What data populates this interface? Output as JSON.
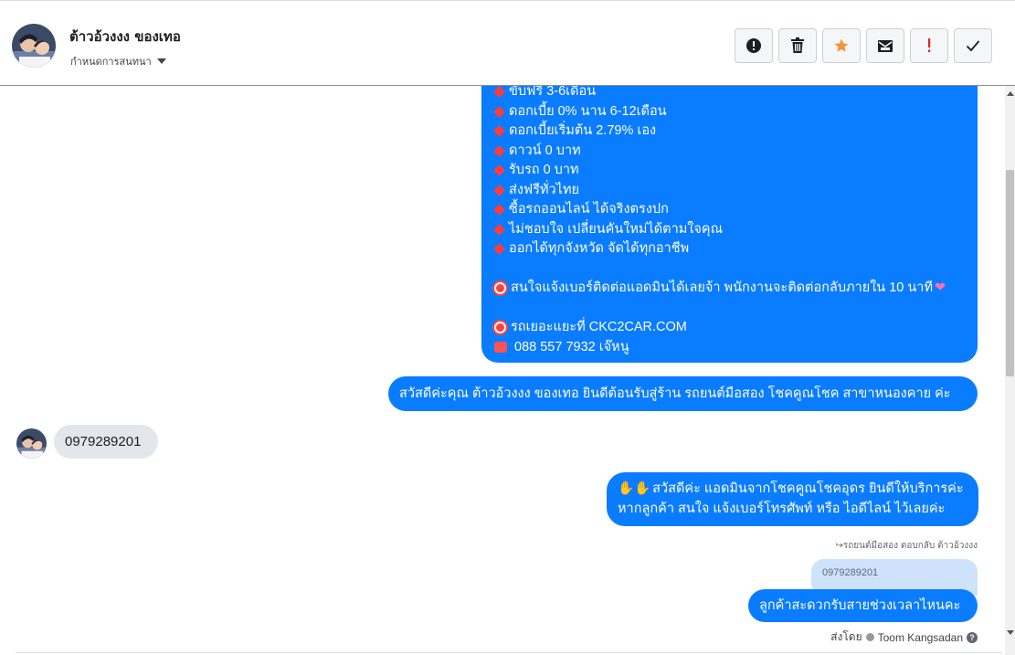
{
  "header": {
    "contact_name": "ต้าวอ้วงงง ของเทอ",
    "assign_label": "กำหนดการสนทนา",
    "actions": [
      {
        "name": "mark-spam-button",
        "icon": "exclamation-circle-icon"
      },
      {
        "name": "delete-button",
        "icon": "trash-icon"
      },
      {
        "name": "star-button",
        "icon": "star-icon"
      },
      {
        "name": "mark-unread-button",
        "icon": "envelope-icon"
      },
      {
        "name": "follow-up-button",
        "icon": "exclamation-icon"
      },
      {
        "name": "done-button",
        "icon": "check-icon"
      }
    ]
  },
  "promo": {
    "lines": [
      "ขับฟรี 3-6เดือน",
      "ดอกเบี้ย 0% นาน 6-12เดือน",
      "ดอกเบี้ยเริ่มต้น 2.79% เอง",
      "ดาวน์ 0 บาท",
      "รับรถ 0 บาท",
      "ส่งฟรีทั่วไทย",
      "ซื้อรถออนไลน์ ได้จริงตรงปก",
      "ไม่ชอบใจ เปลี่ยนคันใหม่ได้ตามใจคุณ",
      "ออกได้ทุกจังหวัด จัดได้ทุกอาชีพ"
    ],
    "contact_line": "สนใจแจ้งเบอร์ติดต่อแอดมินได้เลยจ้า พนักงานจะติดต่อกลับภายใน 10 นาที",
    "website_line": "รถเยอะแยะที่ CKC2CAR.COM",
    "phone_line": "088 557 7932 เจ๊หนู"
  },
  "messages": {
    "welcome": "สวัสดีค่ะคุณ ต้าวอ้วงงง ของเทอ ยินดีต้อนรับสู่ร้าน รถยนต์มือสอง โชคคูณโชค สาขาหนองคาย ค่ะ",
    "customer_phone": "0979289201",
    "greet_line1": "สวัสดีค่ะ แอดมินจากโชคคูณโชคอุดร ยินดีให้บริการค่ะ",
    "greet_line2": "หากลูกค้า สนใจ แจ้งเบอร์โทรศัพท์ หรือ ไอดีไลน์  ไว้เลยค่ะ",
    "reply_meta": "รถยนต์มือสอง ตอบกลับ ต้าวอ้วงงง",
    "quoted_text": "0979289201",
    "ask": "ลูกค้าสะดวกรับสายช่วงเวลาไหนคะ",
    "sent_by_label": "ส่งโดย",
    "sent_by_name": "Toom Kangsadan"
  },
  "colors": {
    "outgoing_bubble": "#0a7cff",
    "incoming_bubble": "#e4e6eb",
    "star": "#f7923a"
  }
}
